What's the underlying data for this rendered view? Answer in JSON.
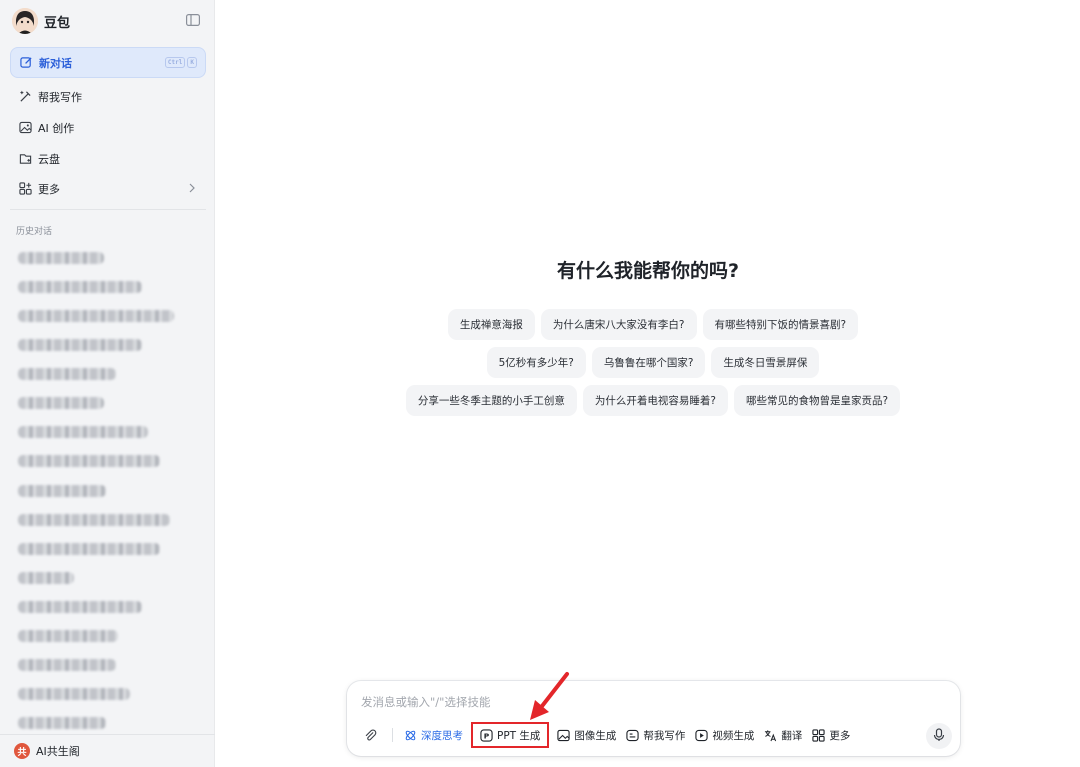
{
  "sidebar": {
    "app_name": "豆包",
    "nav": [
      {
        "label": "新对话",
        "icon": "edit-icon",
        "active": true,
        "shortcut": [
          "Ctrl",
          "K"
        ]
      },
      {
        "label": "帮我写作",
        "icon": "pen-icon"
      },
      {
        "label": "AI 创作",
        "icon": "image-icon"
      },
      {
        "label": "云盘",
        "icon": "cloud-drive-icon"
      },
      {
        "label": "更多",
        "icon": "grid-icon"
      }
    ],
    "history_title": "历史对话",
    "footer_label": "AI共生阁",
    "footer_logo_text": "共"
  },
  "main": {
    "greeting": "有什么我能帮你的吗?",
    "suggestions": [
      [
        "生成禅意海报",
        "为什么唐宋八大家没有李白?",
        "有哪些特别下饭的情景喜剧?"
      ],
      [
        "5亿秒有多少年?",
        "乌鲁鲁在哪个国家?",
        "生成冬日雪景屏保"
      ],
      [
        "分享一些冬季主题的小手工创意",
        "为什么开着电视容易睡着?",
        "哪些常见的食物曾是皇家贡品?"
      ]
    ]
  },
  "composer": {
    "placeholder": "发消息或输入\"/\"选择技能",
    "tools": {
      "deep_think": "深度思考",
      "ppt": "PPT 生成",
      "image": "图像生成",
      "writing": "帮我写作",
      "video": "视频生成",
      "translate": "翻译",
      "more": "更多"
    }
  },
  "colors": {
    "accent": "#2b6be6",
    "highlight_box": "#e3262a",
    "sidebar_bg": "#f3f4f6"
  }
}
